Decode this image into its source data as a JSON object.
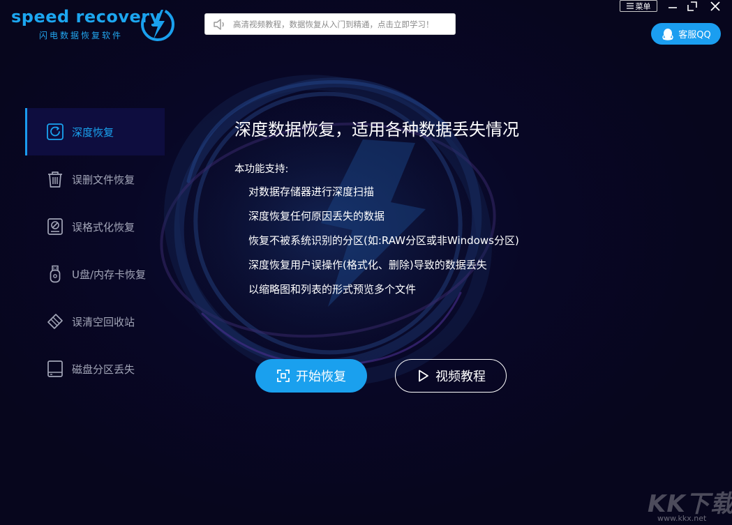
{
  "app": {
    "logo_wordmark": "speed recovery",
    "logo_subtitle": "闪电数据恢复软件",
    "brand_color": "#1aa0ee"
  },
  "notice": {
    "text": "高清视频教程，数据恢复从入门到精通，点击立即学习！",
    "icon": "speaker-icon"
  },
  "window": {
    "menu_label": "菜单",
    "qq_label": "客服QQ"
  },
  "sidebar": {
    "items": [
      {
        "label": "深度恢复",
        "icon": "deep-recovery-icon",
        "active": true
      },
      {
        "label": "误删文件恢复",
        "icon": "trash-icon",
        "active": false
      },
      {
        "label": "误格式化恢复",
        "icon": "format-disk-icon",
        "active": false
      },
      {
        "label": "U盘/内存卡恢复",
        "icon": "usb-icon",
        "active": false
      },
      {
        "label": "误清空回收站",
        "icon": "eraser-icon",
        "active": false
      },
      {
        "label": "磁盘分区丢失",
        "icon": "disk-icon",
        "active": false
      }
    ]
  },
  "main": {
    "title": "深度数据恢复，适用各种数据丢失情况",
    "support_heading": "本功能支持:",
    "features": [
      "对数据存储器进行深度扫描",
      "深度恢复任何原因丢失的数据",
      "恢复不被系统识别的分区(如:RAW分区或非Windows分区)",
      "深度恢复用户误操作(格式化、删除)导致的数据丢失",
      "以缩略图和列表的形式预览多个文件"
    ],
    "start_button": "开始恢复",
    "video_button": "视频教程"
  },
  "watermark": {
    "text": "KK下载",
    "url": "www.kkx.net"
  }
}
